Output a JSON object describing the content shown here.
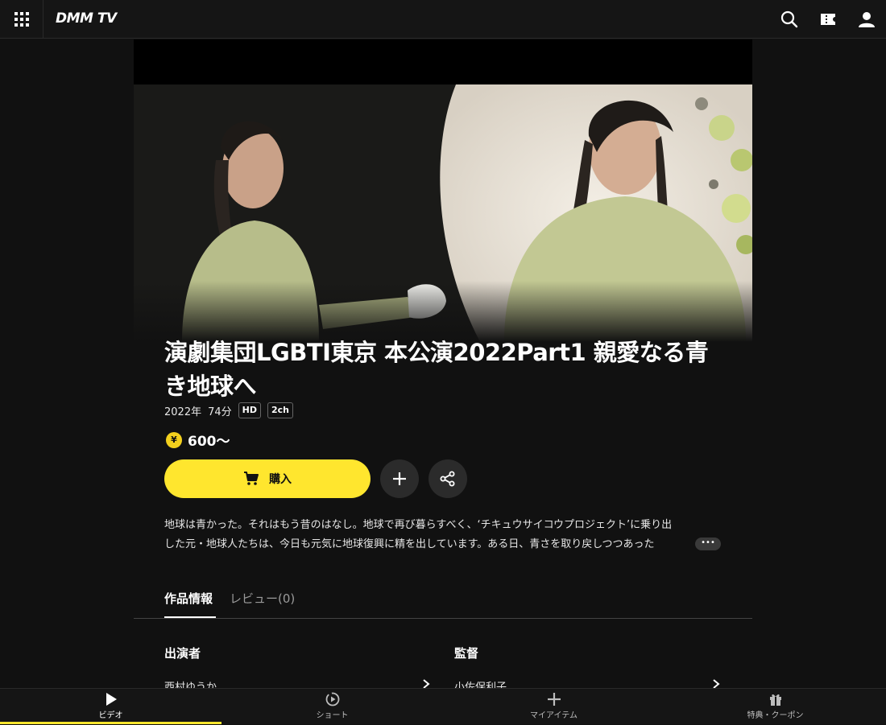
{
  "header": {
    "logo": "DMM TV",
    "icons": [
      "apps-grid-icon",
      "search-icon",
      "ticket-icon",
      "user-icon"
    ]
  },
  "video": {
    "title": "演劇集団LGBTI東京 本公演2022Part1 親愛なる青き地球へ",
    "year": "2022年",
    "duration": "74分",
    "tags": [
      "HD",
      "2ch"
    ],
    "price": "600〜",
    "price_icon": "¥"
  },
  "actions": {
    "buy_label": "購入",
    "add_icon": "plus-icon",
    "share_icon": "share-icon"
  },
  "description": {
    "line1": "地球は青かった。それはもう昔のはなし。地球で再び暮らすべく、‘チキュウサイコウプロジェクト’に乗り出",
    "line2": "した元・地球人たちは、今日も元気に地球復興に精を出しています。ある日、青さを取り戻しつつあった",
    "more": "•••"
  },
  "tabs": [
    {
      "label": "作品情報",
      "active": true
    },
    {
      "label": "レビュー(0)",
      "active": false
    }
  ],
  "credits": {
    "cast_heading": "出演者",
    "cast_first": "西村ゆうか",
    "director_heading": "監督",
    "director_first": "小佐保利子"
  },
  "bottom_nav": [
    {
      "label": "ビデオ",
      "icon": "play-icon",
      "active": true
    },
    {
      "label": "ショート",
      "icon": "shorts-icon",
      "active": false
    },
    {
      "label": "マイアイテム",
      "icon": "plus-icon",
      "active": false
    },
    {
      "label": "特典・クーポン",
      "icon": "gift-icon",
      "active": false
    }
  ],
  "colors": {
    "background": "#111111",
    "accent": "#ffe62e",
    "price_coin": "#f3d01d"
  }
}
